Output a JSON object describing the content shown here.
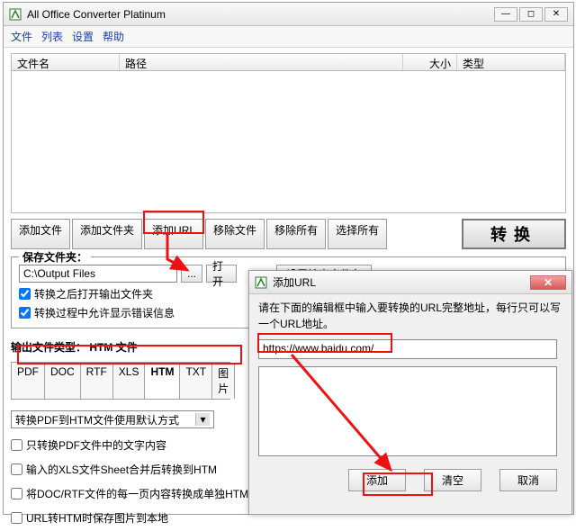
{
  "window": {
    "title": "All Office Converter Platinum",
    "winbtn_min": "—",
    "winbtn_max": "◻",
    "winbtn_close": "✕"
  },
  "menu": {
    "file": "文件",
    "list": "列表",
    "settings": "设置",
    "help": "帮助"
  },
  "columns": {
    "name": "文件名",
    "path": "路径",
    "size": "大小",
    "type": "类型"
  },
  "toolbar": {
    "add_file": "添加文件",
    "add_folder": "添加文件夹",
    "add_url": "添加URL",
    "remove_file": "移除文件",
    "remove_all": "移除所有",
    "select_all": "选择所有",
    "convert": "转换"
  },
  "save_group": {
    "label": "保存文件夹：",
    "path": "C:\\Output Files",
    "browse": "...",
    "open": "打开",
    "set_name": "设置输出文件名",
    "chk_open_after": "转换之后打开输出文件夹",
    "chk_show_errors": "转换过程中允许显示错误信息"
  },
  "outtype": {
    "label_prefix": "输出文件类型：",
    "label_value": "HTM 文件",
    "tabs": [
      "PDF",
      "DOC",
      "RTF",
      "XLS",
      "HTM",
      "TXT",
      "图片"
    ],
    "selected_tab": "HTM",
    "combo": "转换PDF到HTM文件使用默认方式",
    "opt1": "只转换PDF文件中的文字内容",
    "opt2": "输入的XLS文件Sheet合并后转换到HTM",
    "opt3": "将DOC/RTF文件的每一页内容转换成单独HTM",
    "opt4": "URL转HTM时保存图片到本地"
  },
  "dialog": {
    "title": "添加URL",
    "msg": "请在下面的编辑框中输入要转换的URL完整地址，每行只可以写一个URL地址。",
    "input_value": "https://www.baidu.com/",
    "btn_add": "添加",
    "btn_clear": "清空",
    "btn_cancel": "取消",
    "close": "✕"
  }
}
